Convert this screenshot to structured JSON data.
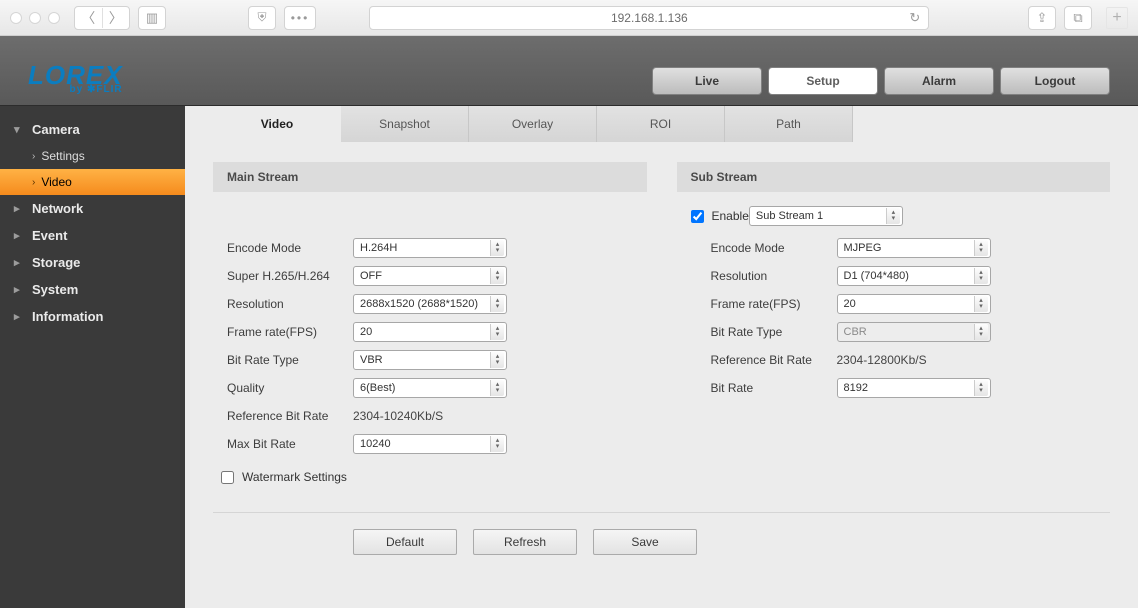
{
  "browser": {
    "url": "192.168.1.136"
  },
  "brand": {
    "name": "LOREX",
    "sub": "by ✱FLIR"
  },
  "mainnav": {
    "live": "Live",
    "setup": "Setup",
    "alarm": "Alarm",
    "logout": "Logout"
  },
  "sidebar": {
    "camera": "Camera",
    "settings": "Settings",
    "video": "Video",
    "network": "Network",
    "event": "Event",
    "storage": "Storage",
    "system": "System",
    "information": "Information"
  },
  "tabs": {
    "video": "Video",
    "snapshot": "Snapshot",
    "overlay": "Overlay",
    "roi": "ROI",
    "path": "Path"
  },
  "mainStream": {
    "title": "Main Stream",
    "encodeModeLabel": "Encode Mode",
    "encodeMode": "H.264H",
    "superLabel": "Super H.265/H.264",
    "super": "OFF",
    "resolutionLabel": "Resolution",
    "resolution": "2688x1520 (2688*1520)",
    "fpsLabel": "Frame rate(FPS)",
    "fps": "20",
    "brTypeLabel": "Bit Rate Type",
    "brType": "VBR",
    "qualityLabel": "Quality",
    "quality": "6(Best)",
    "refLabel": "Reference Bit Rate",
    "ref": "2304-10240Kb/S",
    "maxLabel": "Max Bit Rate",
    "max": "10240",
    "watermarkLabel": "Watermark Settings"
  },
  "subStream": {
    "title": "Sub Stream",
    "enableLabel": "Enable",
    "streamSel": "Sub Stream 1",
    "encodeModeLabel": "Encode Mode",
    "encodeMode": "MJPEG",
    "resolutionLabel": "Resolution",
    "resolution": "D1 (704*480)",
    "fpsLabel": "Frame rate(FPS)",
    "fps": "20",
    "brTypeLabel": "Bit Rate Type",
    "brType": "CBR",
    "refLabel": "Reference Bit Rate",
    "ref": "2304-12800Kb/S",
    "brLabel": "Bit Rate",
    "br": "8192"
  },
  "buttons": {
    "default": "Default",
    "refresh": "Refresh",
    "save": "Save"
  }
}
